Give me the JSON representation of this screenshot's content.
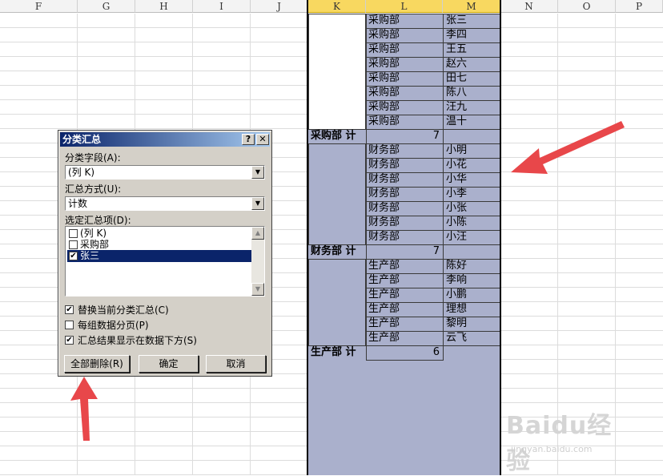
{
  "columns": [
    "F",
    "G",
    "H",
    "I",
    "J",
    "K",
    "L",
    "M",
    "N",
    "O",
    "P"
  ],
  "selected_columns": [
    "K",
    "L",
    "M"
  ],
  "groups": [
    {
      "dept": "采购部",
      "names": [
        "张三",
        "李四",
        "王五",
        "赵六",
        "田七",
        "陈八",
        "汪九",
        "温十"
      ]
    },
    {
      "dept": "财务部",
      "names": [
        "小明",
        "小花",
        "小华",
        "小李",
        "小张",
        "小陈",
        "小汪"
      ]
    },
    {
      "dept": "生产部",
      "names": [
        "陈好",
        "李响",
        "小鹏",
        "理想",
        "黎明",
        "云飞"
      ]
    }
  ],
  "subtotals": [
    {
      "label": "采购部 计",
      "count": "7"
    },
    {
      "label": "财务部 计",
      "count": "7"
    },
    {
      "label": "生产部 计",
      "count": "6"
    }
  ],
  "dialog": {
    "title": "分类汇总",
    "help_label": "?",
    "close_label": "✕",
    "group_field_label": "分类字段(A):",
    "group_field_value": "(列 K)",
    "function_label": "汇总方式(U):",
    "function_value": "计数",
    "items_label": "选定汇总项(D):",
    "items": [
      {
        "label": "(列 K)",
        "checked": false,
        "selected": false
      },
      {
        "label": "采购部",
        "checked": false,
        "selected": false
      },
      {
        "label": "张三",
        "checked": true,
        "selected": true
      }
    ],
    "options": [
      {
        "label": "替换当前分类汇总(C)",
        "checked": true
      },
      {
        "label": "每组数据分页(P)",
        "checked": false
      },
      {
        "label": "汇总结果显示在数据下方(S)",
        "checked": true
      }
    ],
    "remove_all_label": "全部删除(R)",
    "ok_label": "确定",
    "cancel_label": "取消"
  },
  "watermark": {
    "logo": "Baidu经验",
    "url": "jingyan.baidu.com"
  },
  "colors": {
    "selection": "#aab0cc",
    "arrow": "#e8474a",
    "title_bar": "#0a246a",
    "dialog_bg": "#d4d0c8"
  }
}
